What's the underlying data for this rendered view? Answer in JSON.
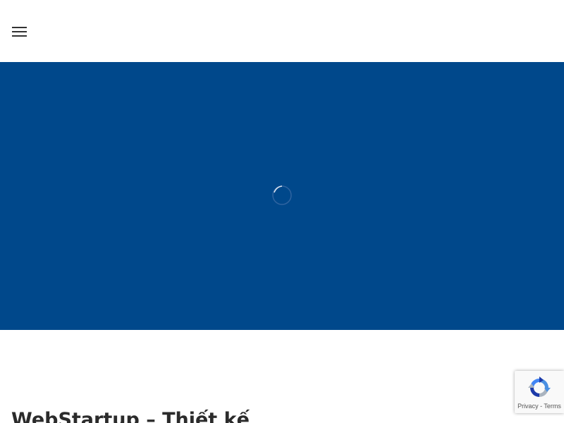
{
  "header": {
    "menu_icon": "hamburger-menu-icon"
  },
  "hero": {
    "background_color": "#00488b",
    "loader_icon": "loading-spinner-icon"
  },
  "main": {
    "headline": "WebStartup – Thiết kế"
  },
  "recaptcha": {
    "logo_icon": "recaptcha-logo-icon",
    "privacy_label": "Privacy",
    "separator": " - ",
    "terms_label": "Terms"
  }
}
